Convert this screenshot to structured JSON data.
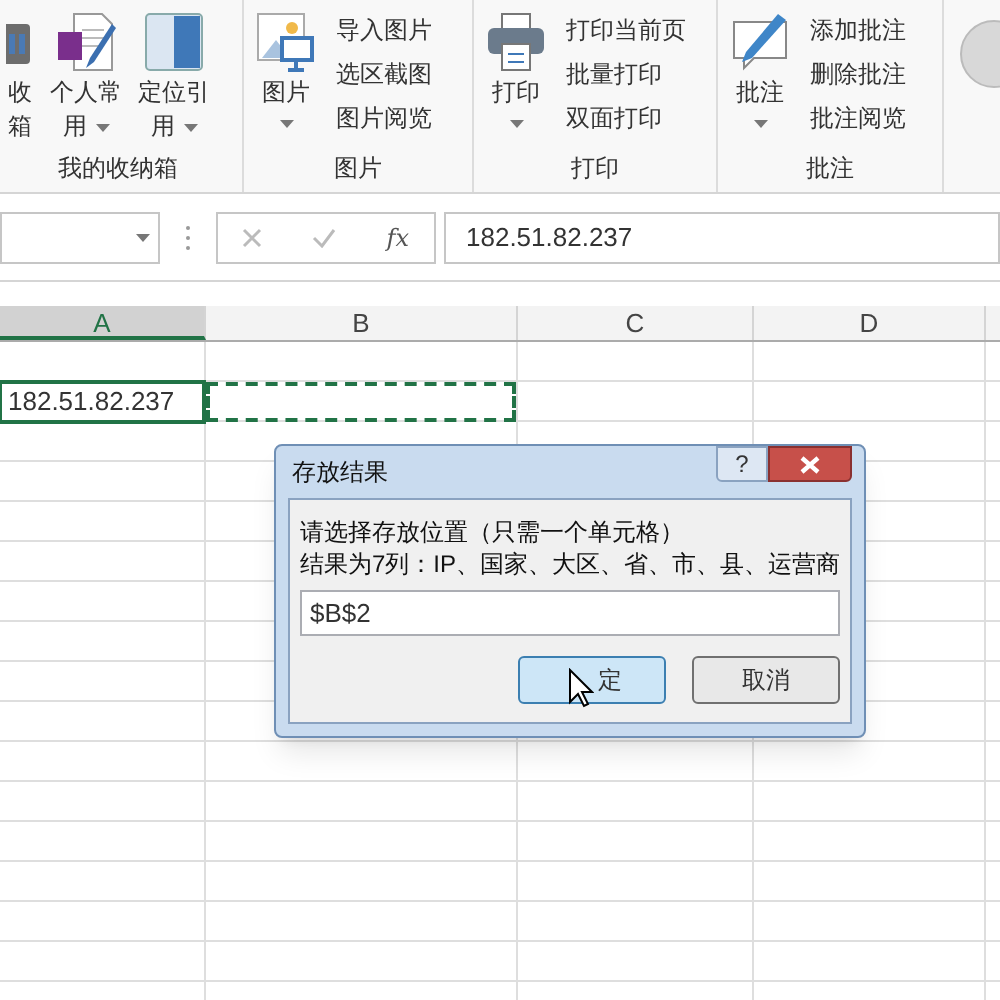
{
  "ribbon": {
    "groups": [
      {
        "label": "我的收纳箱",
        "items": [
          {
            "kind": "large",
            "lines": [
              "收",
              "箱"
            ],
            "dropdown": false
          },
          {
            "kind": "large",
            "lines": [
              "个人常",
              "用"
            ],
            "dropdown": true
          },
          {
            "kind": "large",
            "lines": [
              "定位引",
              "用"
            ],
            "dropdown": true
          }
        ]
      },
      {
        "label": "图片",
        "items": [
          {
            "kind": "large",
            "lines": [
              "图片"
            ],
            "dropdown": true
          },
          {
            "kind": "stack",
            "labels": [
              "导入图片",
              "选区截图",
              "图片阅览"
            ]
          }
        ]
      },
      {
        "label": "打印",
        "items": [
          {
            "kind": "large",
            "lines": [
              "打印"
            ],
            "dropdown": true
          },
          {
            "kind": "stack",
            "labels": [
              "打印当前页",
              "批量打印",
              "双面打印"
            ]
          }
        ]
      },
      {
        "label": "批注",
        "items": [
          {
            "kind": "large",
            "lines": [
              "批注"
            ],
            "dropdown": true
          },
          {
            "kind": "stack",
            "labels": [
              "添加批注",
              "删除批注",
              "批注阅览"
            ]
          }
        ]
      }
    ]
  },
  "formula_bar": {
    "function_label": "fx",
    "value": "182.51.82.237"
  },
  "sheet": {
    "columns": [
      {
        "label": "A",
        "selected": true
      },
      {
        "label": "B",
        "selected": false
      },
      {
        "label": "C",
        "selected": false
      },
      {
        "label": "D",
        "selected": false
      }
    ],
    "second_row": {
      "cells": [
        {
          "text": "182.51.82.237",
          "selected": true,
          "copy_marquee": false
        },
        {
          "selected": false,
          "copy_marquee": true
        }
      ]
    }
  },
  "dialog": {
    "title": "存放结果",
    "help_label": "?",
    "lines": [
      "请选择存放位置（只需一个单元格）",
      "结果为7列：IP、国家、大区、省、市、县、运营商"
    ],
    "input": {
      "value": "$B$2"
    },
    "buttons": [
      {
        "label": "定",
        "focused": true
      },
      {
        "label": "取消",
        "focused": false
      }
    ]
  }
}
